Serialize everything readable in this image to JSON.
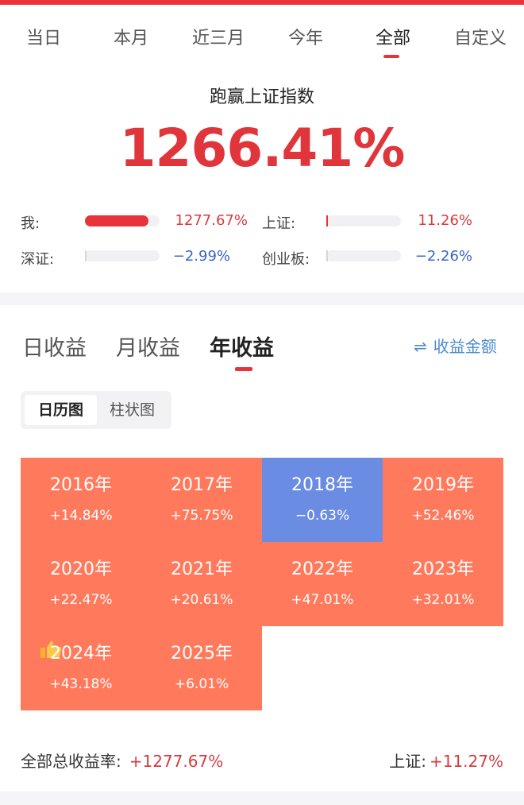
{
  "period_tabs": [
    {
      "label": "当日",
      "active": false
    },
    {
      "label": "本月",
      "active": false
    },
    {
      "label": "近三月",
      "active": false
    },
    {
      "label": "今年",
      "active": false
    },
    {
      "label": "全部",
      "active": true
    },
    {
      "label": "自定义",
      "active": false
    }
  ],
  "summary": {
    "title": "跑赢上证指数",
    "outperform_value": "1266.41%",
    "comparisons": [
      {
        "label": "我:",
        "value": "1277.67%",
        "bar_fraction": 0.85,
        "color": "#e8333a"
      },
      {
        "label": "上证:",
        "value": "11.26%",
        "bar_fraction": 0.02,
        "color": "#e8333a"
      },
      {
        "label": "深证:",
        "value": "−2.99%",
        "bar_fraction": 0.02,
        "color": "#cfd6e4"
      },
      {
        "label": "创业板:",
        "value": "−2.26%",
        "bar_fraction": 0.02,
        "color": "#cfd6e4"
      }
    ]
  },
  "returns_panel": {
    "tabs": [
      {
        "label": "日收益",
        "active": false
      },
      {
        "label": "月收益",
        "active": false
      },
      {
        "label": "年收益",
        "active": true
      }
    ],
    "amount_toggle": {
      "icon": "swap-arrows-icon",
      "label": "收益金额"
    },
    "view_switch": [
      {
        "label": "日历图",
        "active": true
      },
      {
        "label": "柱状图",
        "active": false
      }
    ],
    "years": [
      {
        "year": "2016年",
        "return": "+14.84%",
        "color": "#ff7a5c"
      },
      {
        "year": "2017年",
        "return": "+75.75%",
        "color": "#ff7a5c"
      },
      {
        "year": "2018年",
        "return": "−0.63%",
        "color": "#6b8ce3"
      },
      {
        "year": "2019年",
        "return": "+52.46%",
        "color": "#ff7a5c"
      },
      {
        "year": "2020年",
        "return": "+22.47%",
        "color": "#ff7a5c"
      },
      {
        "year": "2021年",
        "return": "+20.61%",
        "color": "#ff7a5c"
      },
      {
        "year": "2022年",
        "return": "+47.01%",
        "color": "#ff7a5c"
      },
      {
        "year": "2023年",
        "return": "+32.01%",
        "color": "#ff7a5c"
      },
      {
        "year": "2024年",
        "return": "+43.18%",
        "color": "#ff7a5c",
        "badge": "thumbs-up-icon"
      },
      {
        "year": "2025年",
        "return": "+6.01%",
        "color": "#ff7a5c"
      }
    ],
    "total_label": "全部总收益率:",
    "total_value": "+1277.67%",
    "benchmark_label": "上证:",
    "benchmark_value": "+11.27%"
  },
  "colors": {
    "accent": "#e8333a",
    "positive": "#ff7a5c",
    "negative": "#6b8ce3",
    "link": "#4b8ccf"
  }
}
